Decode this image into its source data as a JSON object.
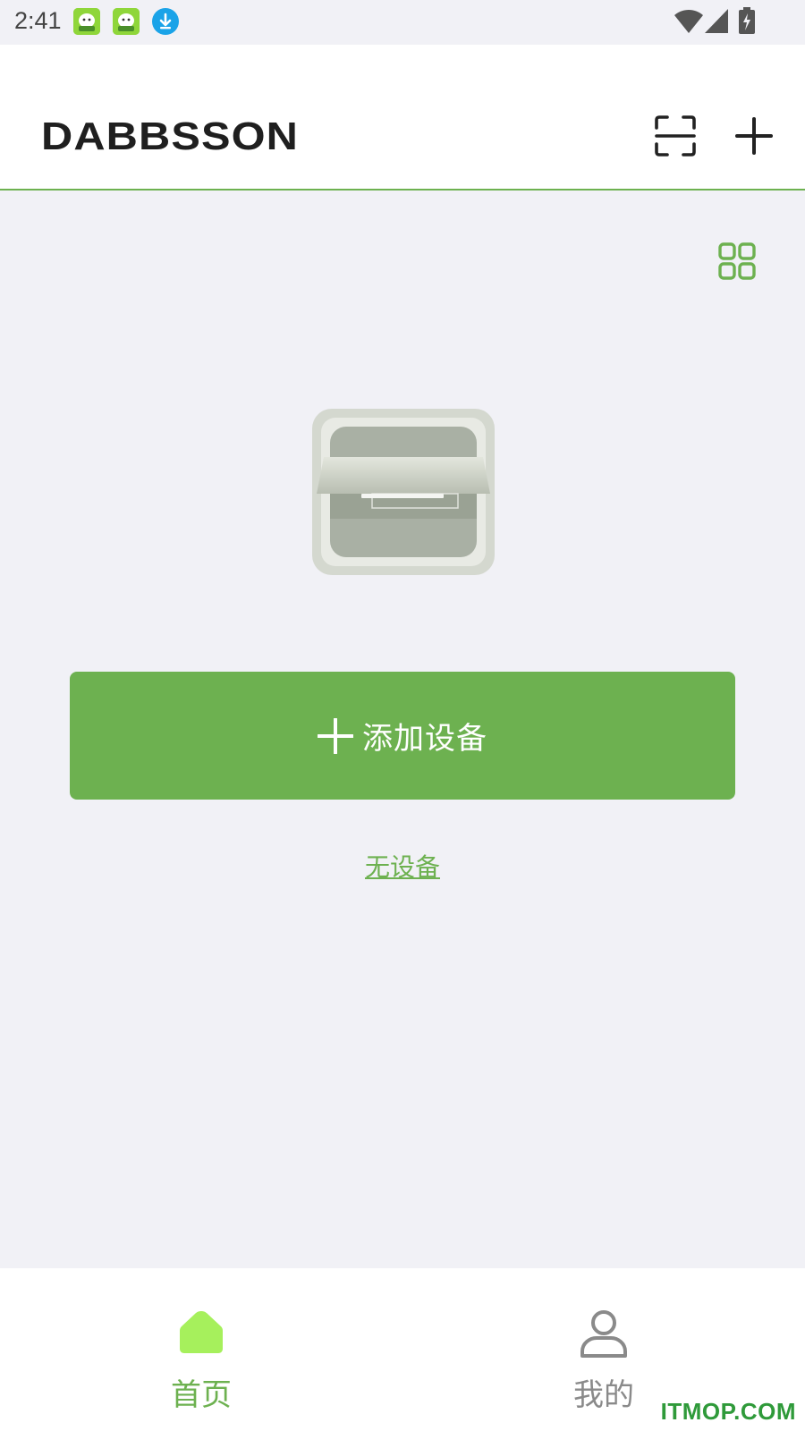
{
  "status_bar": {
    "time": "2:41",
    "notification_icons": [
      "app-mascot-icon",
      "app-mascot-icon",
      "download-icon"
    ],
    "system_icons": [
      "wifi-icon",
      "cell-signal-icon",
      "battery-charging-icon"
    ]
  },
  "header": {
    "logo_text": "DABBSSON",
    "scan_icon": "scan-icon",
    "add_icon": "plus-icon"
  },
  "main": {
    "view_toggle_icon": "grid-view-icon",
    "illustration": "empty-device-box",
    "add_device_label": "添加设备",
    "no_device_text": "无设备"
  },
  "bottom_nav": {
    "items": [
      {
        "label": "首页",
        "icon": "home-icon",
        "active": true
      },
      {
        "label": "我的",
        "icon": "user-icon",
        "active": false
      }
    ]
  },
  "watermark": "ITMOP.COM",
  "colors": {
    "accent": "#6db150",
    "nav_active_icon": "#a6f05c",
    "background": "#f1f1f6",
    "nav_inactive": "#8a8a8a"
  }
}
